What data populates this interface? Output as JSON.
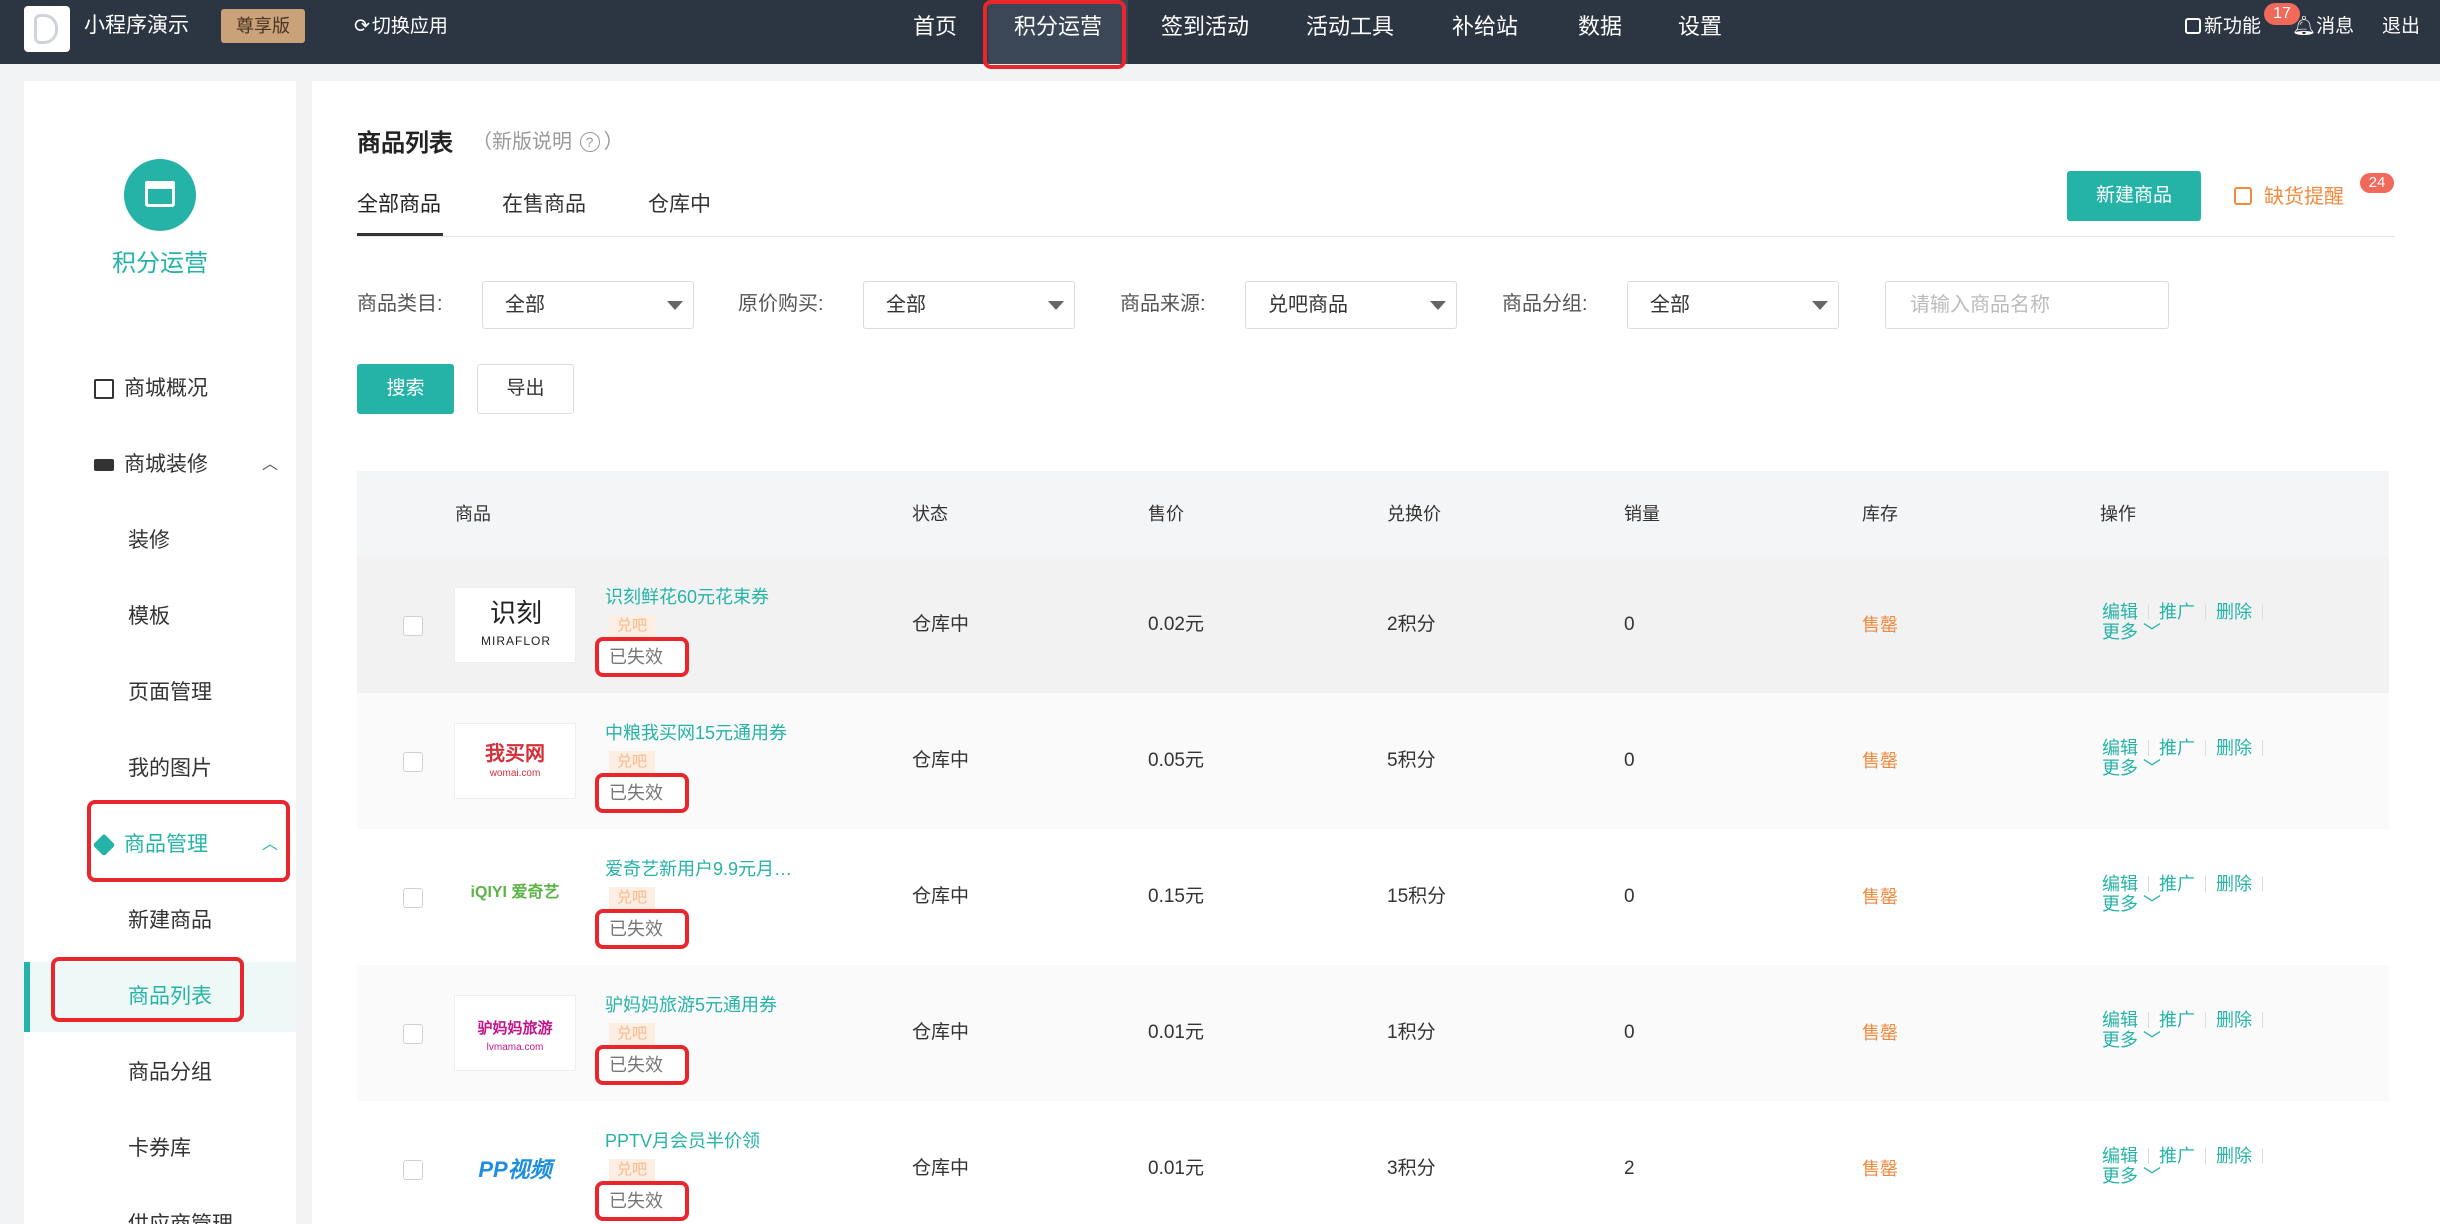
{
  "topbar": {
    "app_name": "小程序演示",
    "plan_badge": "尊享版",
    "switch_app": "切换应用",
    "nav": [
      "首页",
      "积分运营",
      "签到活动",
      "活动工具",
      "补给站",
      "数据",
      "设置"
    ],
    "new_features": "新功能",
    "notification_count": "17",
    "messages": "消息",
    "logout": "退出"
  },
  "sidebar": {
    "title": "积分运营",
    "items": {
      "overview": "商城概况",
      "decoration": "商城装修",
      "decoration_sub": [
        "装修",
        "模板",
        "页面管理",
        "我的图片"
      ],
      "goods_mgmt": "商品管理",
      "goods_sub": [
        "新建商品",
        "商品列表",
        "商品分组",
        "卡券库",
        "供应商管理"
      ]
    }
  },
  "main": {
    "title": "商品列表",
    "note_open": "（",
    "note": "新版说明",
    "note_close": "）",
    "tabs": [
      "全部商品",
      "在售商品",
      "仓库中"
    ],
    "new_button": "新建商品",
    "stock_alert": "缺货提醒",
    "stock_alert_count": "24",
    "filters": [
      {
        "label": "商品类目:",
        "value": "全部"
      },
      {
        "label": "原价购买:",
        "value": "全部"
      },
      {
        "label": "商品来源:",
        "value": "兑吧商品"
      },
      {
        "label": "商品分组:",
        "value": "全部"
      }
    ],
    "search_placeholder": "请输入商品名称",
    "search_button": "搜索",
    "export_button": "导出"
  },
  "table": {
    "headers": [
      "商品",
      "状态",
      "售价",
      "兑换价",
      "销量",
      "库存",
      "操作"
    ],
    "tag_source": "兑吧",
    "tag_expired": "已失效",
    "ops": {
      "edit": "编辑",
      "promote": "推广",
      "delete": "删除",
      "more": "更多"
    },
    "rows": [
      {
        "name": "识刻鲜花60元花束券",
        "status": "仓库中",
        "price": "0.02元",
        "points": "2积分",
        "sales": "0",
        "stock": "售罄",
        "logo_cn": "识刻",
        "logo_en": "MIRAFLOR"
      },
      {
        "name": "中粮我买网15元通用券",
        "status": "仓库中",
        "price": "0.05元",
        "points": "5积分",
        "sales": "0",
        "stock": "售罄",
        "logo_cn": "我买网",
        "logo_en": "womai.com"
      },
      {
        "name": "爱奇艺新用户9.9元月…",
        "status": "仓库中",
        "price": "0.15元",
        "points": "15积分",
        "sales": "0",
        "stock": "售罄",
        "logo_cn": "iQIYI 爱奇艺",
        "logo_en": ""
      },
      {
        "name": "驴妈妈旅游5元通用券",
        "status": "仓库中",
        "price": "0.01元",
        "points": "1积分",
        "sales": "0",
        "stock": "售罄",
        "logo_cn": "驴妈妈旅游",
        "logo_en": "lvmama.com"
      },
      {
        "name": "PPTV月会员半价领",
        "status": "仓库中",
        "price": "0.01元",
        "points": "3积分",
        "sales": "2",
        "stock": "售罄",
        "logo_cn": "PP视频",
        "logo_en": ""
      }
    ]
  },
  "colors": {
    "accent": "#26b3a7",
    "topbar": "#2c3643",
    "highlight": "#e8262b",
    "stock_soldout": "#f08a3f"
  }
}
